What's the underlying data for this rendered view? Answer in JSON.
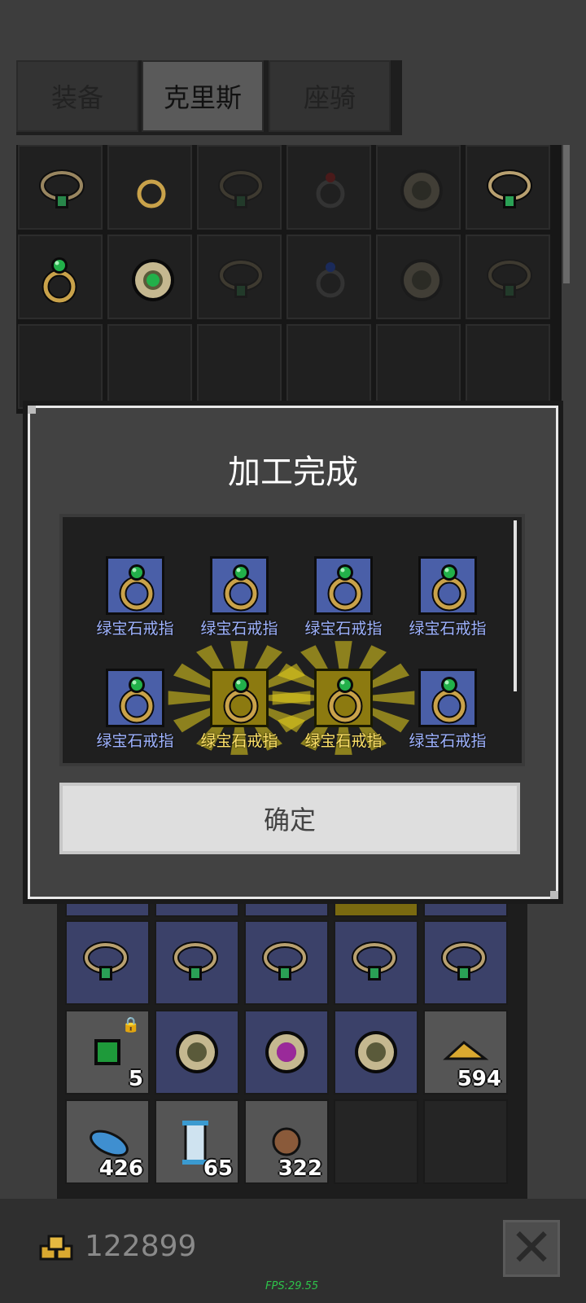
{
  "tabs": [
    {
      "label": "装备",
      "active": false
    },
    {
      "label": "克里斯",
      "active": true
    },
    {
      "label": "座骑",
      "active": false
    }
  ],
  "modal": {
    "title": "加工完成",
    "results": [
      {
        "name": "绿宝石戒指",
        "rarity": "normal"
      },
      {
        "name": "绿宝石戒指",
        "rarity": "normal"
      },
      {
        "name": "绿宝石戒指",
        "rarity": "normal"
      },
      {
        "name": "绿宝石戒指",
        "rarity": "normal"
      },
      {
        "name": "绿宝石戒指",
        "rarity": "normal"
      },
      {
        "name": "绿宝石戒指",
        "rarity": "glowing"
      },
      {
        "name": "绿宝石戒指",
        "rarity": "glowing"
      },
      {
        "name": "绿宝石戒指",
        "rarity": "normal"
      }
    ],
    "confirm_label": "确定"
  },
  "inventory": {
    "counts": {
      "emerald": "5",
      "gold_ore": "594",
      "feather": "426",
      "scroll": "65",
      "ore": "322"
    }
  },
  "footer": {
    "gold": "122899",
    "fps": "FPS:29.55"
  },
  "colors": {
    "rare_frame": "#4a5fa8",
    "glow_frame": "#8c7a10",
    "fps_text": "#2ec24a"
  }
}
